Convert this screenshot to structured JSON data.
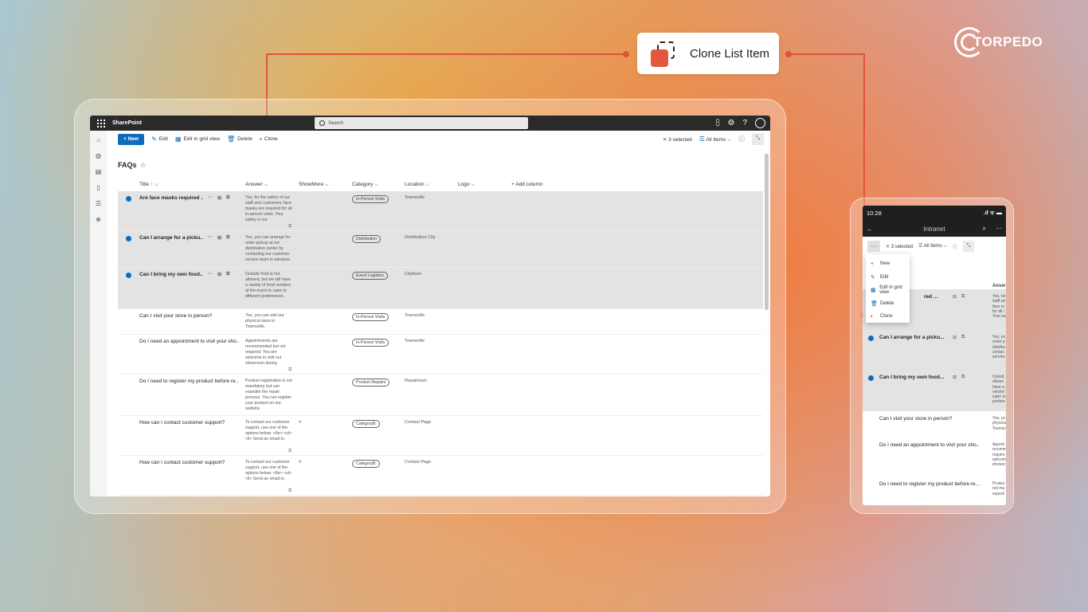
{
  "callout": {
    "label": "Clone List Item"
  },
  "brand": {
    "name": "TORPEDO"
  },
  "colors": {
    "accent": "#e0533a",
    "primary": "#0f6cbd",
    "suite_bar": "#2a2a2a"
  },
  "tablet": {
    "suite": {
      "app": "SharePoint",
      "search_placeholder": "Search",
      "icons": [
        "megaphone-icon",
        "gear-icon",
        "help-icon",
        "avatar-icon"
      ]
    },
    "commands": {
      "new": "New",
      "edit": "Edit",
      "edit_grid": "Edit in grid view",
      "delete": "Delete",
      "clone": "Clone",
      "selected": "3 selected",
      "view": "All Items"
    },
    "list_title": "FAQs",
    "columns": {
      "title": "Title ↑ ⌵",
      "answer": "Answer ⌵",
      "showmore": "ShowMore ⌵",
      "category": "Category ⌵",
      "location": "Location ⌵",
      "logo": "Logo ⌵",
      "add": "+ Add column"
    },
    "rows": [
      {
        "selected": true,
        "title": "Are face masks required ...",
        "answer": "Yes, for the safety of our staff and customers, face masks are required for all in-person visits. Your safety is our",
        "showmore": "",
        "category": "In-Person Visits",
        "location": "Townsville",
        "ext": true
      },
      {
        "selected": true,
        "title": "Can I arrange for a picku...",
        "answer": "Yes, you can arrange for order pickup at our distribution center by contacting our customer service team in advance.",
        "showmore": "",
        "category": "Distribution",
        "location": "Distribution City",
        "ext": false
      },
      {
        "selected": true,
        "title": "Can I bring my own food...",
        "answer": "Outside food is not allowed, but we will have a variety of food vendors at the event to cater to different preferences.",
        "showmore": "",
        "category": "Event Logistics",
        "location": "Citytown",
        "ext": false
      },
      {
        "selected": false,
        "title": "Can I visit your store in person?",
        "answer": "Yes, you can visit our physical store in Townsville.",
        "showmore": "",
        "category": "In-Person Visits",
        "location": "Townsville",
        "ext": false
      },
      {
        "selected": false,
        "title": "Do I need an appointment to visit your sho...",
        "answer": "Appointments are recommended but not required. You are welcome to visit our showroom during",
        "showmore": "",
        "category": "In-Person Visits",
        "location": "Townsville",
        "ext": true
      },
      {
        "selected": false,
        "title": "Do I need to register my product before re...",
        "answer": "Product registration is not mandatory but can expedite the repair process. You can register your product on our website.",
        "showmore": "",
        "category": "Product Repairs",
        "location": "Repairtown",
        "ext": false
      },
      {
        "selected": false,
        "title": "How can I contact customer support?",
        "answer": "To contact our customer support, use one of the options below: </br> <ul><li> Send an email to",
        "showmore": "#",
        "category": "CategoryB",
        "location": "Contact Page",
        "ext": true
      },
      {
        "selected": false,
        "title": "How can I contact customer support?",
        "answer": "To contact our customer support, use one of the options below: </br> <ul><li> Send an email to",
        "showmore": "#",
        "category": "CategoryB",
        "location": "Contact Page",
        "ext": true
      }
    ]
  },
  "phone": {
    "time": "10:28",
    "title": "Intranet",
    "commands": {
      "more": "···",
      "selected": "3 selected",
      "view": "All Items"
    },
    "menu": [
      "New",
      "Edit",
      "Edit in grid view",
      "Delete",
      "Clone"
    ],
    "col_answer": "Answ",
    "rows": [
      {
        "selected": true,
        "title": "red ...",
        "answer": "Yes, for staff an face m for all i Your sa"
      },
      {
        "selected": true,
        "title": "Can I arrange for a picku...",
        "answer": "Yes, yo order p distribu contac service"
      },
      {
        "selected": true,
        "title": "Can I bring my own food...",
        "answer": "Outsid allowe have a vendor cater to prefere"
      },
      {
        "selected": false,
        "title": "Can I visit your store in person?",
        "answer": "Yes, yo physica Townsv"
      },
      {
        "selected": false,
        "title": "Do I need an appointment to visit your sho...",
        "answer": "Appoin recomm require welcom showro"
      },
      {
        "selected": false,
        "title": "Do I need to register my product before re...",
        "answer": "Produc not ma expedi"
      }
    ]
  }
}
